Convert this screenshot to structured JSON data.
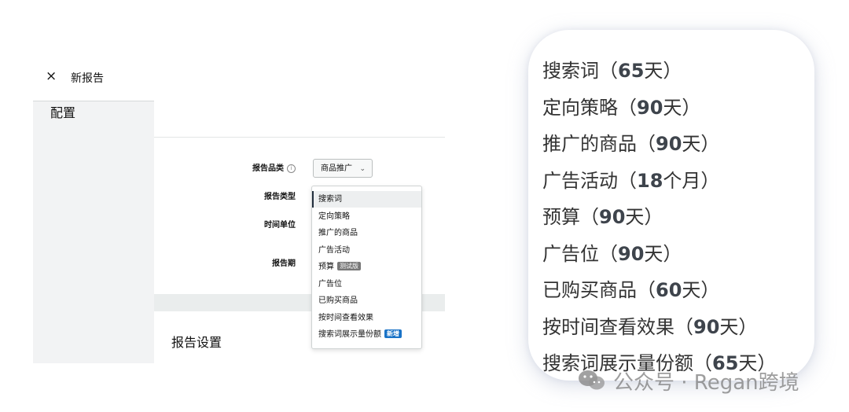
{
  "dialog": {
    "close_glyph": "×",
    "title": "新报告"
  },
  "config": {
    "heading": "配置",
    "category_label": "报告品类",
    "category_info_glyph": "i",
    "category_value": "商品推广",
    "category_chevron": "⌄",
    "type_label": "报告类型",
    "timeunit_label": "时间单位",
    "period_label": "报告期"
  },
  "type_dropdown": {
    "items": [
      {
        "label": "搜索词",
        "badge": "",
        "selected": true
      },
      {
        "label": "定向策略",
        "badge": "",
        "selected": false
      },
      {
        "label": "推广的商品",
        "badge": "",
        "selected": false
      },
      {
        "label": "广告活动",
        "badge": "",
        "selected": false
      },
      {
        "label": "预算",
        "badge": "测试版",
        "selected": false
      },
      {
        "label": "广告位",
        "badge": "",
        "selected": false
      },
      {
        "label": "已购买商品",
        "badge": "",
        "selected": false
      },
      {
        "label": "按时间查看效果",
        "badge": "",
        "selected": false
      },
      {
        "label": "搜索词展示量份额",
        "badge": "新增",
        "selected": false
      }
    ]
  },
  "settings": {
    "heading": "报告设置"
  },
  "retention": {
    "items": [
      {
        "name": "搜索词",
        "open": "（",
        "period": "65",
        "unit": "天",
        "close": "）"
      },
      {
        "name": "定向策略",
        "open": "（",
        "period": "90",
        "unit": "天",
        "close": "）"
      },
      {
        "name": "推广的商品",
        "open": "（",
        "period": "90",
        "unit": "天",
        "close": "）"
      },
      {
        "name": "广告活动",
        "open": "（",
        "period": "18",
        "unit": "个月",
        "close": "）"
      },
      {
        "name": "预算",
        "open": "（",
        "period": "90",
        "unit": "天",
        "close": "）"
      },
      {
        "name": "广告位",
        "open": "（",
        "period": "90",
        "unit": "天",
        "close": "）"
      },
      {
        "name": "已购买商品",
        "open": "（",
        "period": "60",
        "unit": "天",
        "close": "）"
      },
      {
        "name": "按时间查看效果",
        "open": "（",
        "period": "90",
        "unit": "天",
        "close": "）"
      },
      {
        "name": "搜索词展示量份额",
        "open": "（",
        "period": "65",
        "unit": "天",
        "close": "）"
      }
    ]
  },
  "watermark": {
    "text": "公众号 · Regan跨境",
    "icon": "wechat-icon"
  },
  "colors": {
    "dropdown_selected_bar": "#232f3e",
    "badge_new": "#1a73c7",
    "badge_beta": "#777777"
  }
}
